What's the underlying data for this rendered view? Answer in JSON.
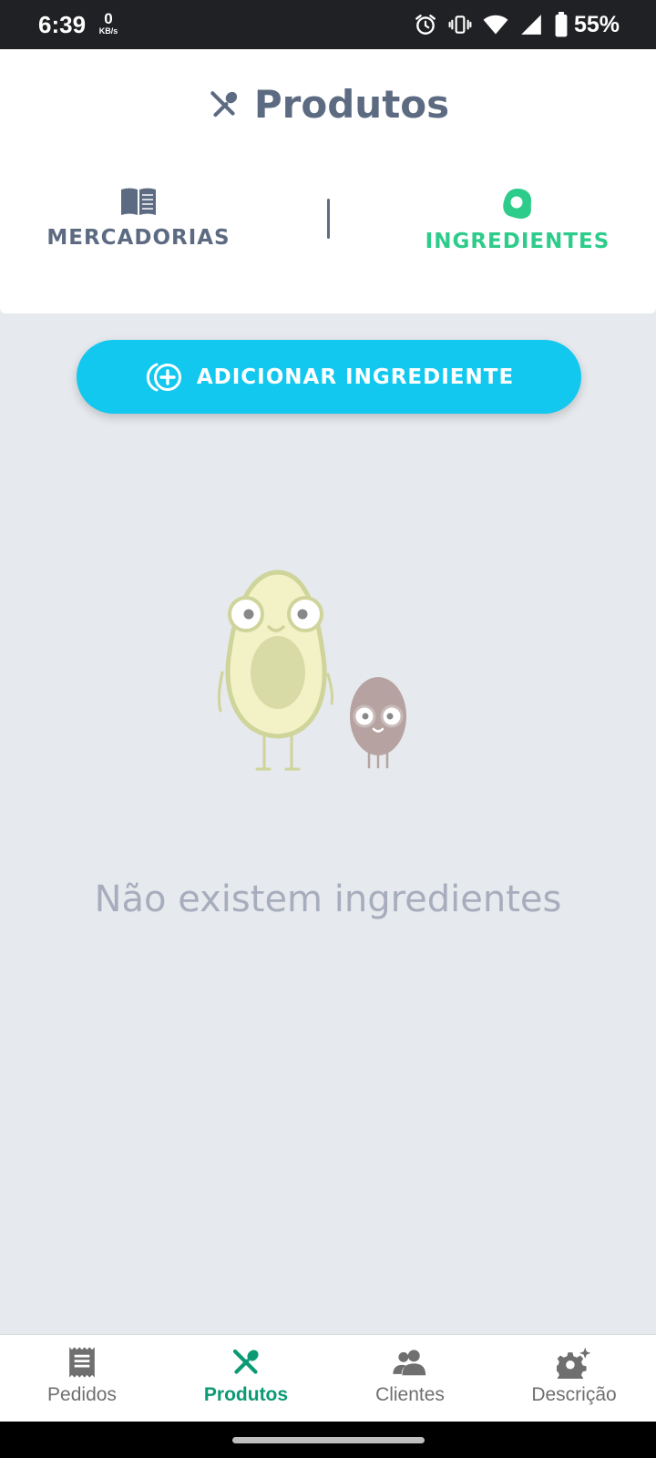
{
  "status_bar": {
    "time": "6:39",
    "net_speed_value": "0",
    "net_speed_unit": "KB/s",
    "battery_percent": "55%",
    "icons": [
      "alarm-icon",
      "vibrate-icon",
      "wifi-icon",
      "signal-icon",
      "battery-icon"
    ]
  },
  "header": {
    "title": "Produtos",
    "title_icon": "fork-spoon-icon"
  },
  "tabs": [
    {
      "label": "MERCADORIAS",
      "icon": "book-icon",
      "active": false
    },
    {
      "label": "INGREDIENTES",
      "icon": "egg-icon",
      "active": true
    }
  ],
  "add_button": {
    "label": "ADICIONAR INGREDIENTE",
    "icon": "add-circle-icon"
  },
  "empty_state": {
    "message": "Não existem ingredientes",
    "illustration": "avocado-and-seed-characters"
  },
  "bottom_nav": {
    "items": [
      {
        "label": "Pedidos",
        "icon": "receipt-icon",
        "active": false
      },
      {
        "label": "Produtos",
        "icon": "fork-spoon-icon",
        "active": true
      },
      {
        "label": "Clientes",
        "icon": "people-icon",
        "active": false
      },
      {
        "label": "Descrição",
        "icon": "settings-sparkle-icon",
        "active": false
      }
    ]
  },
  "colors": {
    "accent_green": "#2ecc8a",
    "nav_active": "#0b9a74",
    "button_blue": "#12c8ef",
    "text_slate": "#5d6b82",
    "background": "#e6e9ed"
  }
}
